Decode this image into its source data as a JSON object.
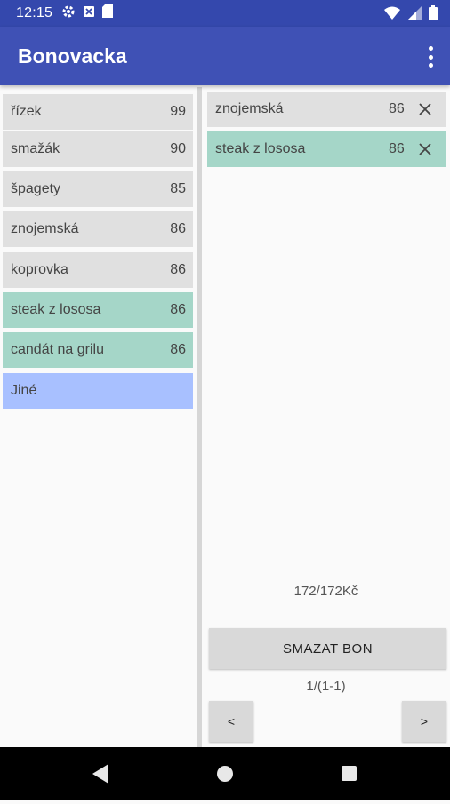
{
  "status_bar": {
    "time": "12:15"
  },
  "app": {
    "title": "Bonovacka"
  },
  "menu_items": [
    {
      "name": "řízek",
      "price": "99"
    },
    {
      "name": "smažák",
      "price": "90"
    },
    {
      "name": "špagety",
      "price": "85"
    },
    {
      "name": "znojemská",
      "price": "86"
    },
    {
      "name": "koprovka",
      "price": "86"
    },
    {
      "name": "steak z lososa",
      "price": "86"
    },
    {
      "name": "candát na grilu",
      "price": "86"
    },
    {
      "name": "Jiné",
      "price": ""
    }
  ],
  "bon_items": [
    {
      "name": "znojemská",
      "price": "86"
    },
    {
      "name": "steak z lososa",
      "price": "86"
    }
  ],
  "total": "172/172Kč",
  "delete_button": "SMAZAT BON",
  "pager": "1/(1-1)",
  "prev_button": "<",
  "next_button": ">",
  "colors": {
    "status_bar": "#3448ad",
    "app_bar": "#3f51b5",
    "item_default": "#e0e0e0",
    "item_selected": "#a5d6c8",
    "item_other": "#a8c0ff"
  }
}
